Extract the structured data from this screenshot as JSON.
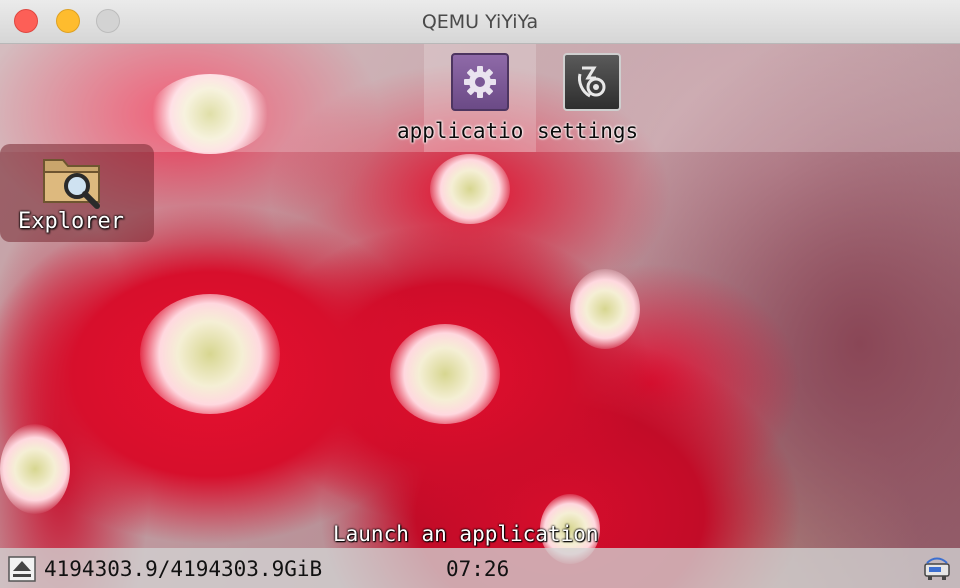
{
  "window": {
    "title": "QEMU YiYiYa",
    "controls": [
      "close-icon",
      "minimize-icon",
      "maximize-icon"
    ],
    "control_colors": {
      "close": "#fd5f57",
      "minimize": "#febc2e",
      "maximize": "#d3d3d3"
    }
  },
  "launcher": {
    "apps": [
      {
        "label": "applicatio",
        "icon": "gear-icon",
        "color": "#7a5796"
      },
      {
        "label": "settings",
        "icon": "settings-icon",
        "color": "#3a3a3a"
      }
    ]
  },
  "desktop": {
    "explorer": {
      "label": "Explorer",
      "icon": "folder-search-icon"
    },
    "hint": "Launch an application"
  },
  "status": {
    "storage": "4194303.9/4194303.9GiB",
    "clock": "07:26",
    "icons": [
      "eject-icon",
      "network-icon"
    ]
  }
}
